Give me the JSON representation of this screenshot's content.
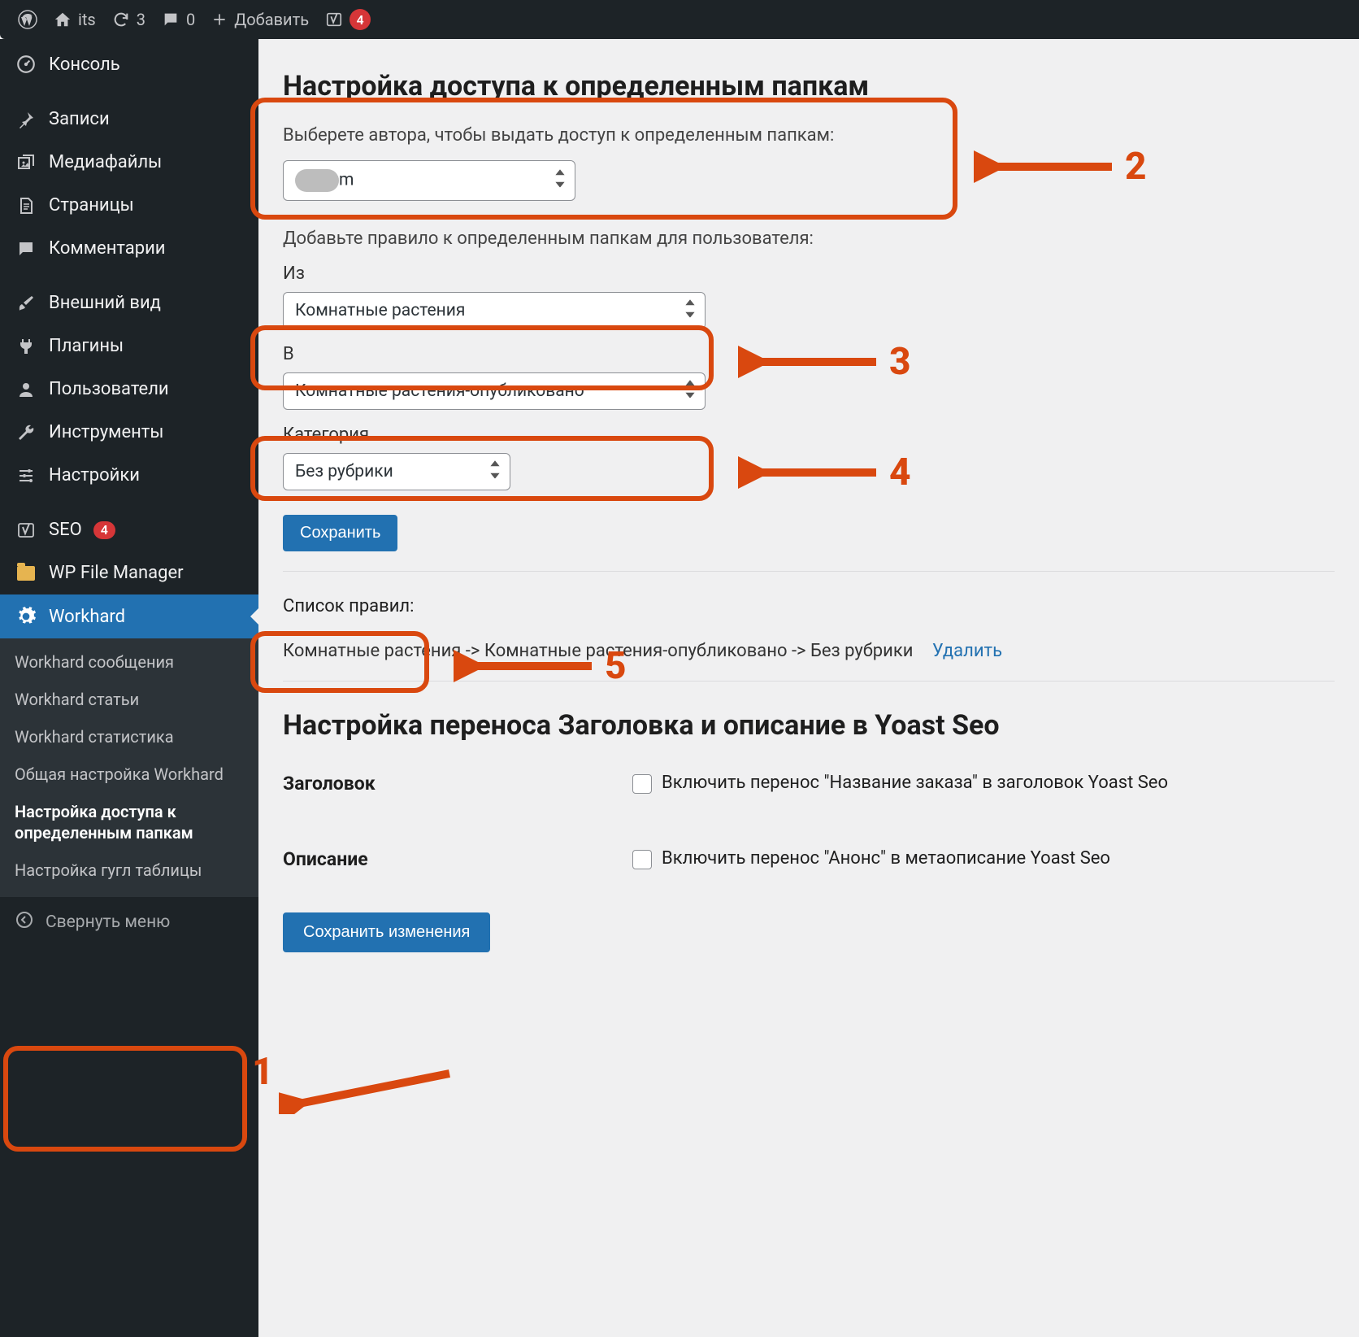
{
  "adminbar": {
    "site_name": "its",
    "updates_count": "3",
    "comments_count": "0",
    "new_label": "Добавить",
    "yoast_badge": "4"
  },
  "sidebar": {
    "items": [
      {
        "icon": "dashboard",
        "label": "Консоль"
      },
      {
        "icon": "pin",
        "label": "Записи"
      },
      {
        "icon": "media",
        "label": "Медиафайлы"
      },
      {
        "icon": "pages",
        "label": "Страницы"
      },
      {
        "icon": "comments",
        "label": "Комментарии"
      },
      {
        "icon": "appearance",
        "label": "Внешний вид"
      },
      {
        "icon": "plugins",
        "label": "Плагины"
      },
      {
        "icon": "users",
        "label": "Пользователи"
      },
      {
        "icon": "tools",
        "label": "Инструменты"
      },
      {
        "icon": "settings",
        "label": "Настройки"
      },
      {
        "icon": "seo",
        "label": "SEO",
        "count": "4"
      },
      {
        "icon": "folder",
        "label": "WP File Manager"
      },
      {
        "icon": "gear",
        "label": "Workhard",
        "current": true
      }
    ],
    "submenu": [
      {
        "label": "Workhard сообщения"
      },
      {
        "label": "Workhard статьи"
      },
      {
        "label": "Workhard статистика"
      },
      {
        "label": "Общая настройка Workhard"
      },
      {
        "label": "Настройка доступа к определенным папкам",
        "current": true
      },
      {
        "label": "Настройка гугл таблицы"
      }
    ],
    "collapse_label": "Свернуть меню"
  },
  "main": {
    "heading1": "Настройка доступа к определенным папкам",
    "author_help": "Выберете автора, чтобы выдать доступ к определенным папкам:",
    "author_value_suffix": "m",
    "rule_help": "Добавьте правило к определенным папкам для пользователя:",
    "from_label": "Из",
    "from_value": "Комнатные растения",
    "to_label": "В",
    "to_value": "Комнатные растения-опубликовано",
    "cat_label": "Категория",
    "cat_value": "Без рубрики",
    "save_btn": "Сохранить",
    "rules_list_label": "Список правил:",
    "rule_text": "Комнатные растения -> Комнатные растения-опубликовано -> Без рубрики",
    "rule_delete": "Удалить",
    "heading2": "Настройка переноса Заголовка и описание в Yoast Seo",
    "yoast_title_label": "Заголовок",
    "yoast_title_chk": "Включить перенос \"Название заказа\" в заголовок Yoast Seo",
    "yoast_desc_label": "Описание",
    "yoast_desc_chk": "Включить перенос \"Анонс\" в метаописание Yoast Seo",
    "save_changes_btn": "Сохранить изменения"
  },
  "annotations": {
    "n1": "1",
    "n2": "2",
    "n3": "3",
    "n4": "4",
    "n5": "5"
  }
}
